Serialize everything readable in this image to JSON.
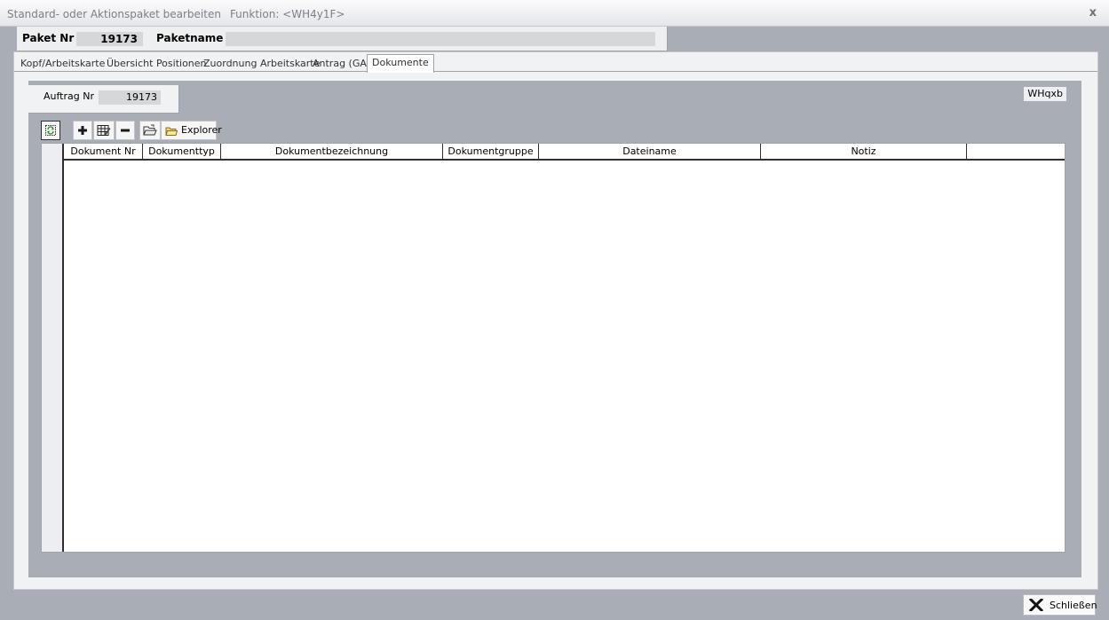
{
  "window": {
    "title": "Standard- oder Aktionspaket bearbeiten",
    "function": "Funktion: <WH4y1F>",
    "close_glyph": "x"
  },
  "header": {
    "paket_nr_label": "Paket Nr",
    "paket_nr_value": "19173",
    "paketname_label": "Paketname",
    "paketname_value": ""
  },
  "tabs": [
    {
      "label": "Kopf/Arbeitskarte"
    },
    {
      "label": "Übersicht Positionen"
    },
    {
      "label": "Zuordnung Arbeitskarte"
    },
    {
      "label": "Antrag (GA)"
    },
    {
      "label": "Dokumente"
    }
  ],
  "active_tab": "Dokumente",
  "dokumente": {
    "auftrag_label": "Auftrag Nr",
    "auftrag_value": "19173",
    "form_code": "WHqxb",
    "toolbar": {
      "refresh_icon": "refresh-icon",
      "add_icon": "plus-icon",
      "edit_icon": "edit-grid-icon",
      "remove_icon": "minus-icon",
      "open_icon": "open-folder-icon",
      "explorer_label": "Explorer"
    },
    "columns": [
      "Dokument Nr",
      "Dokumenttyp",
      "Dokumentbezeichnung",
      "Dokumentgruppe",
      "Dateiname",
      "Notiz"
    ],
    "rows": []
  },
  "footer": {
    "close_label": "Schließen"
  }
}
